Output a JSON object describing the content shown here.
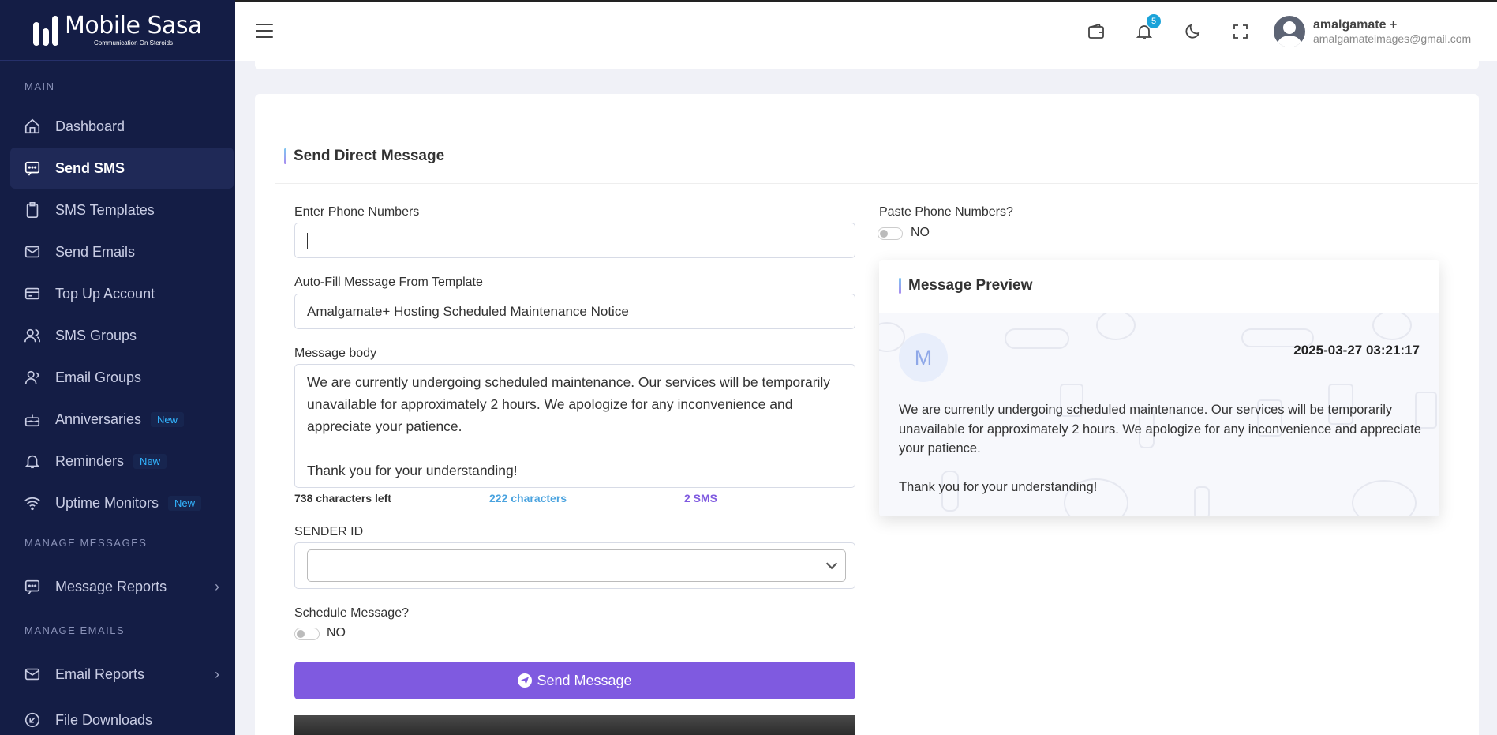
{
  "brand": {
    "name": "Mobile Sasa",
    "tagline": "Communication On Steroids"
  },
  "sidebar": {
    "sections": {
      "main": "MAIN",
      "manage_messages": "MANAGE MESSAGES",
      "manage_emails": "MANAGE EMAILS"
    },
    "items": [
      {
        "label": "Dashboard",
        "icon": "home-icon"
      },
      {
        "label": "Send SMS",
        "icon": "message-icon",
        "active": true
      },
      {
        "label": "SMS Templates",
        "icon": "clipboard-icon"
      },
      {
        "label": "Send Emails",
        "icon": "mail-icon"
      },
      {
        "label": "Top Up Account",
        "icon": "credit-card-icon"
      },
      {
        "label": "SMS Groups",
        "icon": "users-icon"
      },
      {
        "label": "Email Groups",
        "icon": "user-icon"
      },
      {
        "label": "Anniversaries",
        "icon": "cake-icon",
        "badge": "New"
      },
      {
        "label": "Reminders",
        "icon": "bell-icon",
        "badge": "New"
      },
      {
        "label": "Uptime Monitors",
        "icon": "wifi-icon",
        "badge": "New"
      },
      {
        "label": "Message Reports",
        "icon": "message-icon"
      },
      {
        "label": "Email Reports",
        "icon": "mail-icon"
      },
      {
        "label": "File Downloads",
        "icon": "download-icon"
      }
    ],
    "chevron": "›"
  },
  "topbar": {
    "notification_count": "5",
    "user_name": "amalgamate +",
    "user_email": "amalgamateimages@gmail.com"
  },
  "form": {
    "title": "Send Direct Message",
    "phone_label": "Enter Phone Numbers",
    "phone_value": "",
    "paste_label": "Paste Phone Numbers?",
    "paste_state": "NO",
    "template_label": "Auto-Fill Message From Template",
    "template_value": "Amalgamate+ Hosting Scheduled Maintenance Notice",
    "body_label": "Message body",
    "body_value": "We are currently undergoing scheduled maintenance. Our services will be temporarily unavailable for approximately 2 hours. We apologize for any inconvenience and appreciate your patience.\n\nThank you for your understanding!",
    "chars_left": "738 characters left",
    "chars_count": "222 characters",
    "sms_count": "2 SMS",
    "sender_label": "SENDER ID",
    "sender_value": "",
    "schedule_label": "Schedule Message?",
    "schedule_state": "NO",
    "send_label": "Send Message"
  },
  "preview": {
    "title": "Message Preview",
    "avatar_letter": "M",
    "date": "2025-03-27 03:21:17",
    "body": "We are currently undergoing scheduled maintenance. Our services will be temporarily unavailable for approximately 2 hours. We apologize for any inconvenience and appreciate your patience.\n\nThank you for your understanding!"
  },
  "colors": {
    "sidebar_bg": "#141d45",
    "accent_purple": "#7f5ae0",
    "chars_count_color": "#4aa3df",
    "sms_count_color": "#7f5ae0"
  }
}
